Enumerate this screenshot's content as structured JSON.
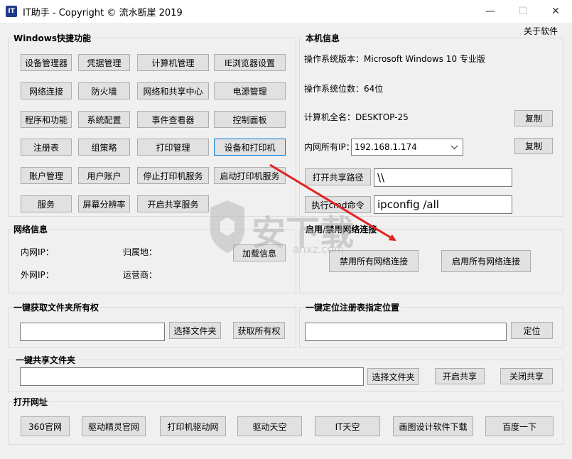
{
  "window": {
    "title": "IT助手 - Copyright © 流水断崖 2019",
    "icon_text": "IT",
    "minimize": "—",
    "maximize": "☐",
    "close": "✕",
    "about": "关于软件"
  },
  "windows_shortcuts": {
    "title": "Windows快捷功能",
    "buttons": [
      [
        "设备管理器",
        "凭据管理",
        "计算机管理",
        "IE浏览器设置"
      ],
      [
        "网络连接",
        "防火墙",
        "网络和共享中心",
        "电源管理"
      ],
      [
        "程序和功能",
        "系统配置",
        "事件查看器",
        "控制面板"
      ],
      [
        "注册表",
        "组策略",
        "打印管理",
        "设备和打印机"
      ],
      [
        "账户管理",
        "用户账户",
        "停止打印机服务",
        "启动打印机服务"
      ],
      [
        "服务",
        "屏幕分辨率",
        "开启共享服务"
      ]
    ]
  },
  "local_info": {
    "title": "本机信息",
    "os_version": "操作系统版本：Microsoft Windows 10 专业版",
    "os_bits": "操作系统位数：64位",
    "computer_name": "计算机全名：DESKTOP-25",
    "copy_label": "复制",
    "lan_ip_label": "内网所有IP：",
    "lan_ip_value": "192.168.1.174",
    "copy_label2": "复制",
    "open_share_button": "打开共享路径",
    "share_path_value": "\\\\",
    "run_cmd_button": "执行cmd命令",
    "cmd_value": "ipconfig /all"
  },
  "network_info": {
    "title": "网络信息",
    "lan_ip": "内网IP：",
    "location": "归属地：",
    "wan_ip": "外网IP：",
    "isp": "运营商：",
    "load_button": "加载信息"
  },
  "toggle_network": {
    "title": "启用/禁用网络连接",
    "disable_all": "禁用所有网络连接",
    "enable_all": "启用所有网络连接"
  },
  "folder_ownership": {
    "title": "一键获取文件夹所有权",
    "path_value": "",
    "select_button": "选择文件夹",
    "take_button": "获取所有权"
  },
  "registry_locate": {
    "title": "一键定位注册表指定位置",
    "path_value": "",
    "locate_button": "定位"
  },
  "share_folder": {
    "title": "一键共享文件夹",
    "path_value": "",
    "select_button": "选择文件夹",
    "open_share": "开启共享",
    "close_share": "关闭共享"
  },
  "open_urls": {
    "title": "打开网址",
    "buttons": [
      "360官网",
      "驱动精灵官网",
      "打印机驱动网",
      "驱动天空",
      "IT天空",
      "画图设计软件下载",
      "百度一下"
    ]
  },
  "watermark": {
    "text": "安下载",
    "subtext": "anxz.com"
  },
  "colors": {
    "arrow": "#e32222",
    "focus_border": "#0078d7"
  }
}
